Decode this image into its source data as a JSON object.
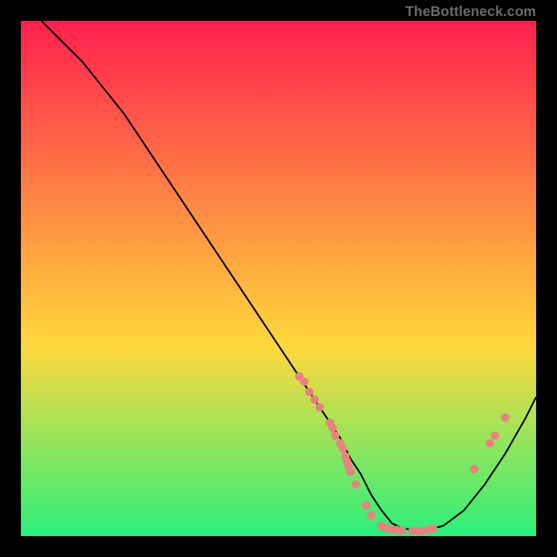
{
  "watermark": "TheBottleneck.com",
  "chart_data": {
    "type": "line",
    "title": "",
    "xlabel": "",
    "ylabel": "",
    "xlim": [
      0,
      100
    ],
    "ylim": [
      0,
      100
    ],
    "grid": false,
    "legend": false,
    "background_gradient": {
      "top": "#ff1f4f",
      "middle": "#ffd83b",
      "bottom": "#2bf07a"
    },
    "series": [
      {
        "name": "curve",
        "stroke": "#000000",
        "x": [
          4,
          8,
          12,
          16,
          20,
          24,
          28,
          32,
          36,
          40,
          44,
          48,
          52,
          56,
          58,
          60,
          62,
          64,
          66,
          68,
          70,
          72,
          74,
          78,
          82,
          86,
          90,
          94,
          98,
          100
        ],
        "y": [
          100,
          96,
          92,
          87,
          82,
          76,
          70,
          64,
          58,
          52,
          46,
          40,
          34,
          28,
          25,
          22,
          19,
          15,
          12,
          8,
          5,
          2.5,
          1.5,
          1,
          2,
          5,
          10,
          16,
          23,
          27
        ]
      }
    ],
    "markers": {
      "color": "#e98180",
      "radius": 6,
      "points": [
        {
          "x": 54,
          "y": 31
        },
        {
          "x": 55,
          "y": 30
        },
        {
          "x": 56,
          "y": 28
        },
        {
          "x": 57,
          "y": 26.5
        },
        {
          "x": 58,
          "y": 25
        },
        {
          "x": 60,
          "y": 22
        },
        {
          "x": 60.5,
          "y": 21
        },
        {
          "x": 61,
          "y": 19.5
        },
        {
          "x": 62,
          "y": 18
        },
        {
          "x": 62.5,
          "y": 17
        },
        {
          "x": 63,
          "y": 15.5
        },
        {
          "x": 63.3,
          "y": 14.5
        },
        {
          "x": 63.6,
          "y": 13.5
        },
        {
          "x": 64,
          "y": 12.5
        },
        {
          "x": 65,
          "y": 10
        },
        {
          "x": 67,
          "y": 6
        },
        {
          "x": 68,
          "y": 4
        },
        {
          "x": 70,
          "y": 2
        },
        {
          "x": 71,
          "y": 1.5
        },
        {
          "x": 72,
          "y": 1.3
        },
        {
          "x": 73,
          "y": 1.2
        },
        {
          "x": 74,
          "y": 1.1
        },
        {
          "x": 76,
          "y": 1
        },
        {
          "x": 77,
          "y": 1
        },
        {
          "x": 78,
          "y": 1
        },
        {
          "x": 79,
          "y": 1.2
        },
        {
          "x": 80,
          "y": 1.5
        },
        {
          "x": 88,
          "y": 13
        },
        {
          "x": 91,
          "y": 18
        },
        {
          "x": 92,
          "y": 19.5
        },
        {
          "x": 94,
          "y": 23
        }
      ]
    },
    "bottom_band": {
      "color": "#2bf07a",
      "y_height_fraction": 0.018
    }
  }
}
